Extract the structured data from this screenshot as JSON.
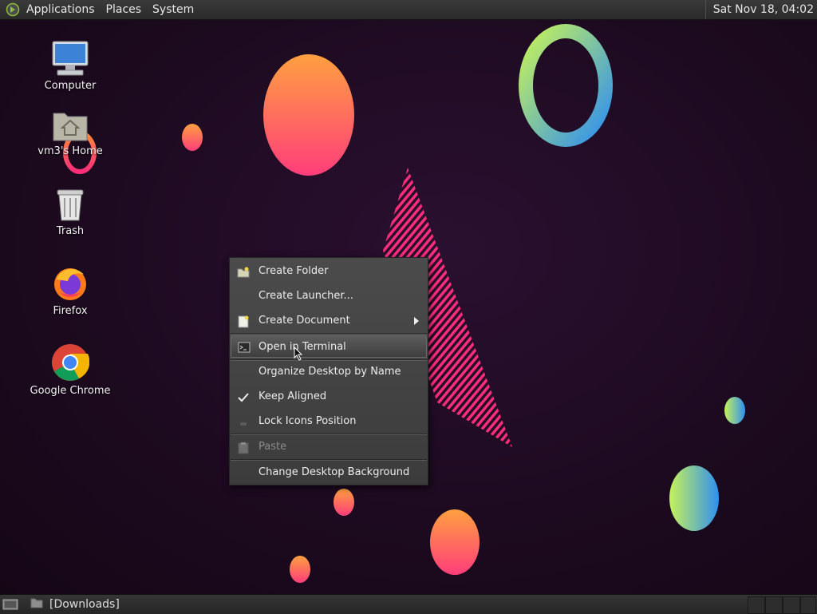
{
  "top_panel": {
    "menus": [
      "Applications",
      "Places",
      "System"
    ],
    "clock": "Sat Nov 18, 04:02"
  },
  "desktop_icons": [
    {
      "label": "Computer",
      "icon": "computer-icon"
    },
    {
      "label": "vm3's Home",
      "icon": "home-folder-icon"
    },
    {
      "label": "Trash",
      "icon": "trash-icon"
    },
    {
      "label": "Firefox",
      "icon": "firefox-icon"
    },
    {
      "label": "Google Chrome",
      "icon": "chrome-icon"
    }
  ],
  "context_menu": {
    "items": [
      {
        "label": "Create Folder",
        "icon": "folder-new-icon"
      },
      {
        "label": "Create Launcher...",
        "icon": ""
      },
      {
        "label": "Create Document",
        "icon": "document-new-icon",
        "submenu": true
      },
      {
        "label": "Open in Terminal",
        "icon": "terminal-icon",
        "highlighted": true
      },
      {
        "label": "Organize Desktop by Name",
        "icon": ""
      },
      {
        "label": "Keep Aligned",
        "icon": "checkmark-icon",
        "checked": true
      },
      {
        "label": "Lock Icons Position",
        "icon": "lock-icon"
      },
      {
        "label": "Paste",
        "icon": "paste-icon",
        "disabled": true
      },
      {
        "label": "Change Desktop Background",
        "icon": ""
      }
    ]
  },
  "bottom_panel": {
    "task": "[Downloads]"
  },
  "colors": {
    "wallpaper_bg": "#1c0b1e",
    "accent_orange": "#ff8a3c",
    "accent_pink": "#ff2d7a",
    "accent_green": "#b8f05a",
    "accent_blue": "#3aa0f0"
  }
}
